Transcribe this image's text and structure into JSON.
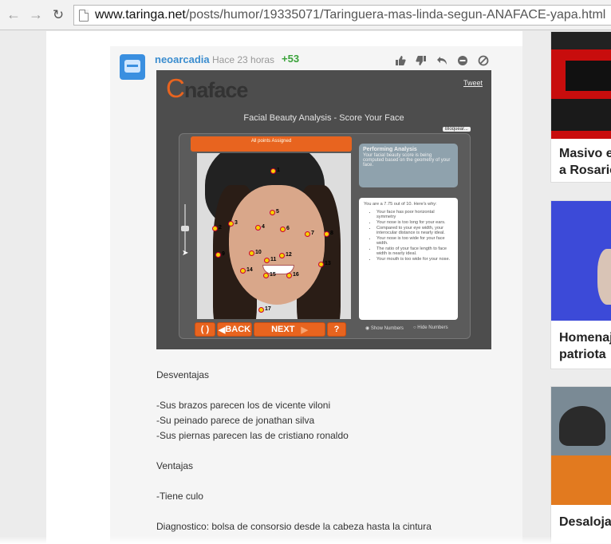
{
  "browser": {
    "url_host": "www.taringa.net",
    "url_path": "/posts/humor/19335071/Taringuera-mas-linda-segun-ANAFACE-yapa.html"
  },
  "comment": {
    "username": "neoarcadia",
    "timestamp": "Hace 23 horas",
    "score": "+53",
    "actions": [
      "thumbs-up-icon",
      "thumbs-down-icon",
      "reply-icon",
      "hide-icon",
      "block-icon"
    ]
  },
  "anaface": {
    "logo": "naface",
    "tweet": "Tweet",
    "title": "Facial Beauty Analysis - Score Your Face",
    "bloquear": "Bloquear...",
    "assigned": "All points Assigned",
    "performing_title": "Performing Analysis",
    "performing_text": "Your facial beauty score is being computed based on the geometry of your face.",
    "score_text": "You are a 7.75 out of 10.  Here's why:",
    "reasons": [
      "Your face has poor horizontal symmetry",
      "Your nose is too long for your ears.",
      "Compared to your eye width, your interocular distance is nearly ideal.",
      "Your nose is too wide for your face width.",
      "The ratio of your face length to face width is nearly ideal.",
      "Your mouth is too wide for your nose."
    ],
    "btn_reset": "( )",
    "btn_back": "BACK",
    "btn_next": "NEXT",
    "btn_help": "?",
    "show_numbers": "Show Numbers",
    "hide_numbers": "Hide Numbers",
    "points": [
      "1",
      "2",
      "3",
      "4",
      "5",
      "6",
      "7",
      "8",
      "9",
      "10",
      "11",
      "12",
      "13",
      "14",
      "15",
      "16",
      "17"
    ]
  },
  "body_text": {
    "desventajas": "Desventajas",
    "d1": "-Sus brazos parecen los de vicente viloni",
    "d2": "-Su peinado parece de jonathan silva",
    "d3": "-Sus piernas parecen las de cristiano ronaldo",
    "ventajas": "Ventajas",
    "v1": "-Tiene culo",
    "diagnostico": "Diagnostico: bolsa de consorsio desde la cabeza hasta la cintura"
  },
  "sidebar": {
    "card1_line1": "Masivo e",
    "card1_line2": "a Rosario",
    "card2_line1": "Homenaj",
    "card2_line2": "patriota",
    "card3_line1": "Desaloja"
  }
}
